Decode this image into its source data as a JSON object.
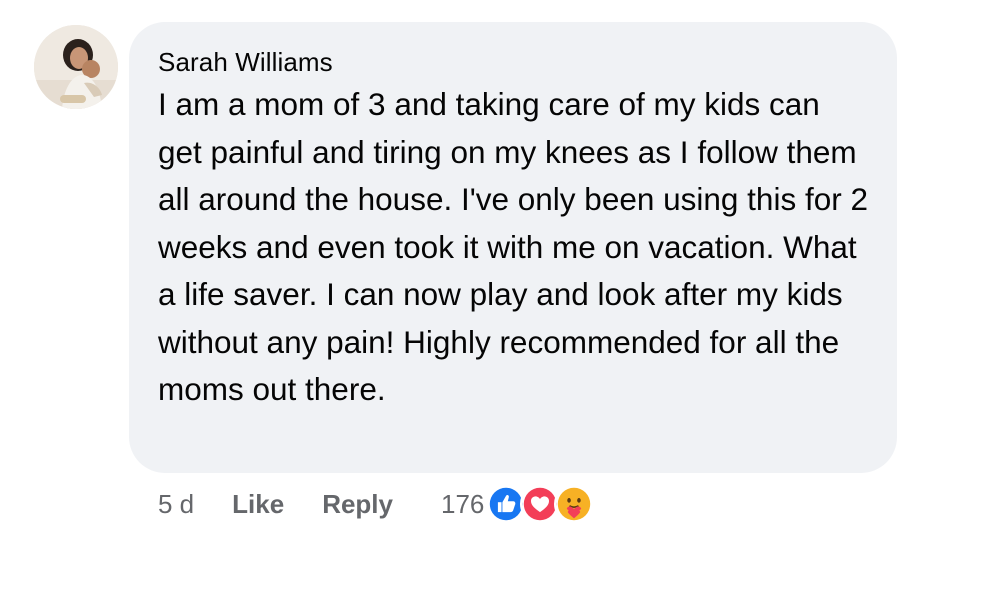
{
  "comment": {
    "author": "Sarah Williams",
    "text": "I am a mom of 3 and taking care of my kids can get painful and tiring on my knees as I follow them all around the house. I've only been using this for 2 weeks and even took it with me on vacation. What a life saver. I can now play and look after my kids without any pain! Highly recommended for all the moms out there.",
    "avatar_icon": "user-avatar-photo"
  },
  "actions": {
    "timestamp": "5 d",
    "like_label": "Like",
    "reply_label": "Reply"
  },
  "reactions": {
    "count": "176",
    "icons": [
      "like-icon",
      "love-icon",
      "care-icon"
    ],
    "colors": {
      "like": "#1877f2",
      "love": "#f33e58",
      "care": "#f7b125"
    }
  },
  "colors": {
    "bubble_bg": "#f0f2f5",
    "secondary_text": "#65676b",
    "primary_text": "#050505"
  }
}
